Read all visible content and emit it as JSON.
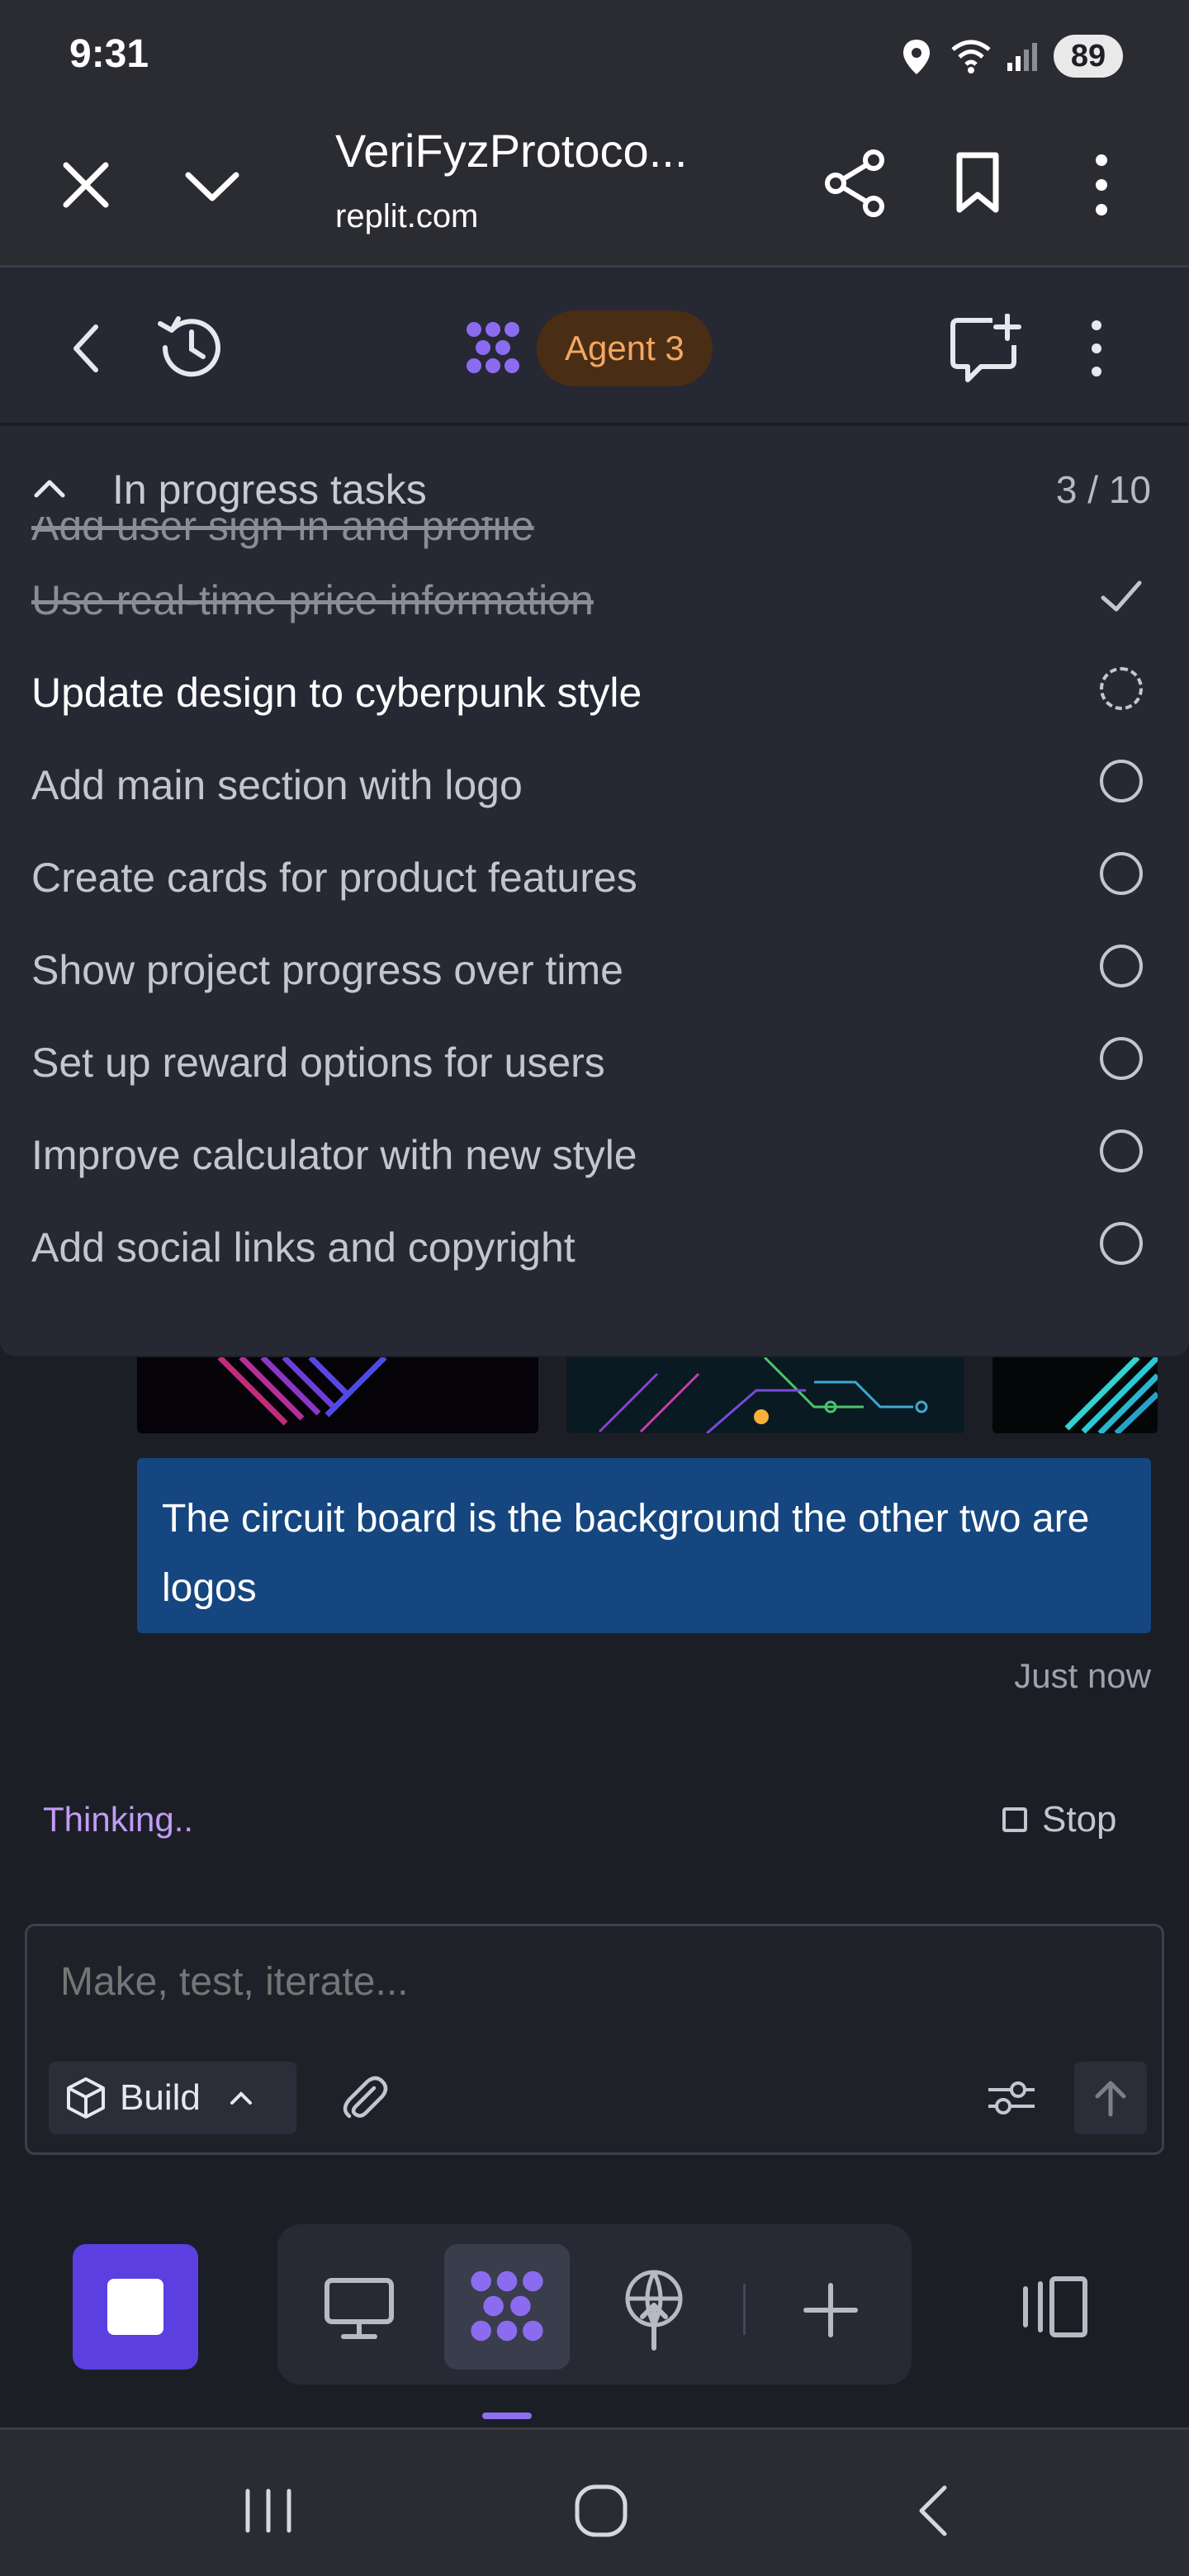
{
  "status_bar": {
    "time": "9:31",
    "battery": "89"
  },
  "browser": {
    "page_title": "VeriFyzProtoco...",
    "url": "replit.com"
  },
  "app_header": {
    "agent_label": "Agent 3"
  },
  "tasks": {
    "title": "In progress tasks",
    "count": "3 / 10",
    "partial_item": "Add user sign-in and profile",
    "items": [
      {
        "label": "Use real-time price information",
        "status": "done"
      },
      {
        "label": "Update design to cyberpunk style",
        "status": "in_progress"
      },
      {
        "label": "Add main section with logo",
        "status": "pending"
      },
      {
        "label": "Create cards for product features",
        "status": "pending"
      },
      {
        "label": "Show project progress over time",
        "status": "pending"
      },
      {
        "label": "Set up reward options for users",
        "status": "pending"
      },
      {
        "label": "Improve calculator with new style",
        "status": "pending"
      },
      {
        "label": "Add social links and copyright",
        "status": "pending"
      }
    ]
  },
  "chat": {
    "message": "The circuit board is the background the other two are logos",
    "timestamp": "Just now",
    "thinking": "Thinking..",
    "stop_label": "Stop"
  },
  "composer": {
    "placeholder": "Make, test, iterate...",
    "mode_label": "Build"
  },
  "colors": {
    "accent": "#5b3fe0",
    "agent_pill_bg": "#4a2d15",
    "agent_pill_text": "#f3a760",
    "message_bg": "#15467f",
    "thinking_text": "#c19cf5"
  }
}
